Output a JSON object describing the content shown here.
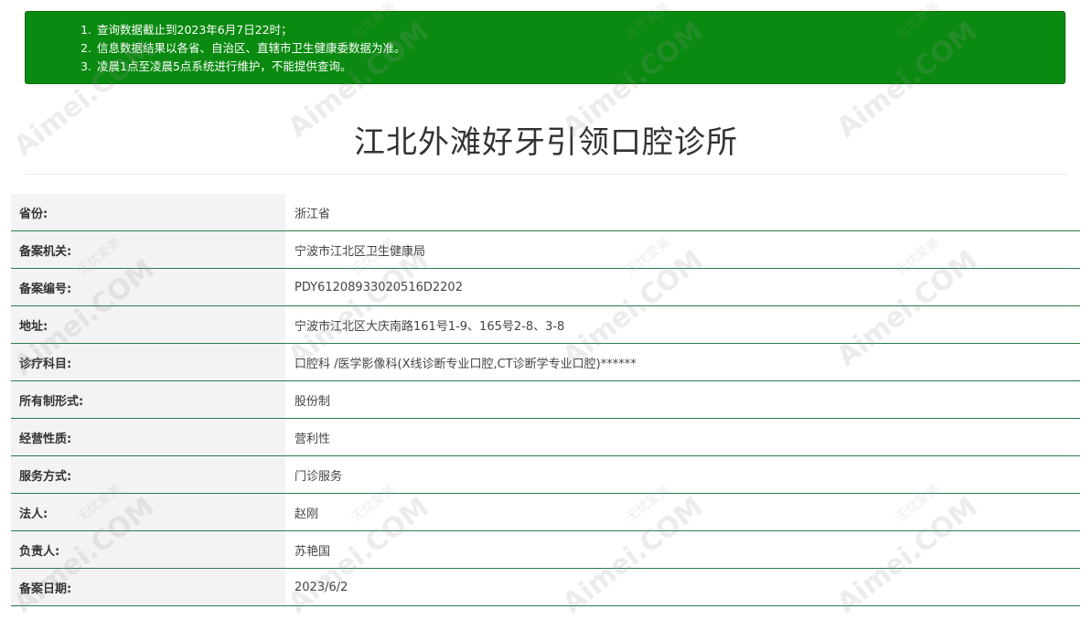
{
  "notice": {
    "items": [
      "查询数据截止到2023年6月7日22时；",
      "信息数据结果以各省、自治区、直辖市卫生健康委数据为准。",
      "凌晨1点至凌晨5点系统进行维护，不能提供查询。"
    ],
    "background": "#0a8a10"
  },
  "page_title": "江北外滩好牙引领口腔诊所",
  "rows": [
    {
      "label": "省份:",
      "value": "浙江省"
    },
    {
      "label": "备案机关:",
      "value": "宁波市江北区卫生健康局"
    },
    {
      "label": "备案编号:",
      "value": "PDY61208933020516D2202"
    },
    {
      "label": "地址:",
      "value": "宁波市江北区大庆南路161号1-9、165号2-8、3-8"
    },
    {
      "label": "诊疗科目:",
      "value": "口腔科 /医学影像科(X线诊断专业口腔,CT诊断学专业口腔)******"
    },
    {
      "label": "所有制形式:",
      "value": "股份制"
    },
    {
      "label": "经营性质:",
      "value": "营利性"
    },
    {
      "label": "服务方式:",
      "value": "门诊服务"
    },
    {
      "label": "法人:",
      "value": "赵刚"
    },
    {
      "label": "负责人:",
      "value": "苏艳国"
    },
    {
      "label": "备案日期:",
      "value": "2023/6/2"
    }
  ],
  "watermark": {
    "brand": "Aimei.COM",
    "cn": "无忧爱美"
  }
}
